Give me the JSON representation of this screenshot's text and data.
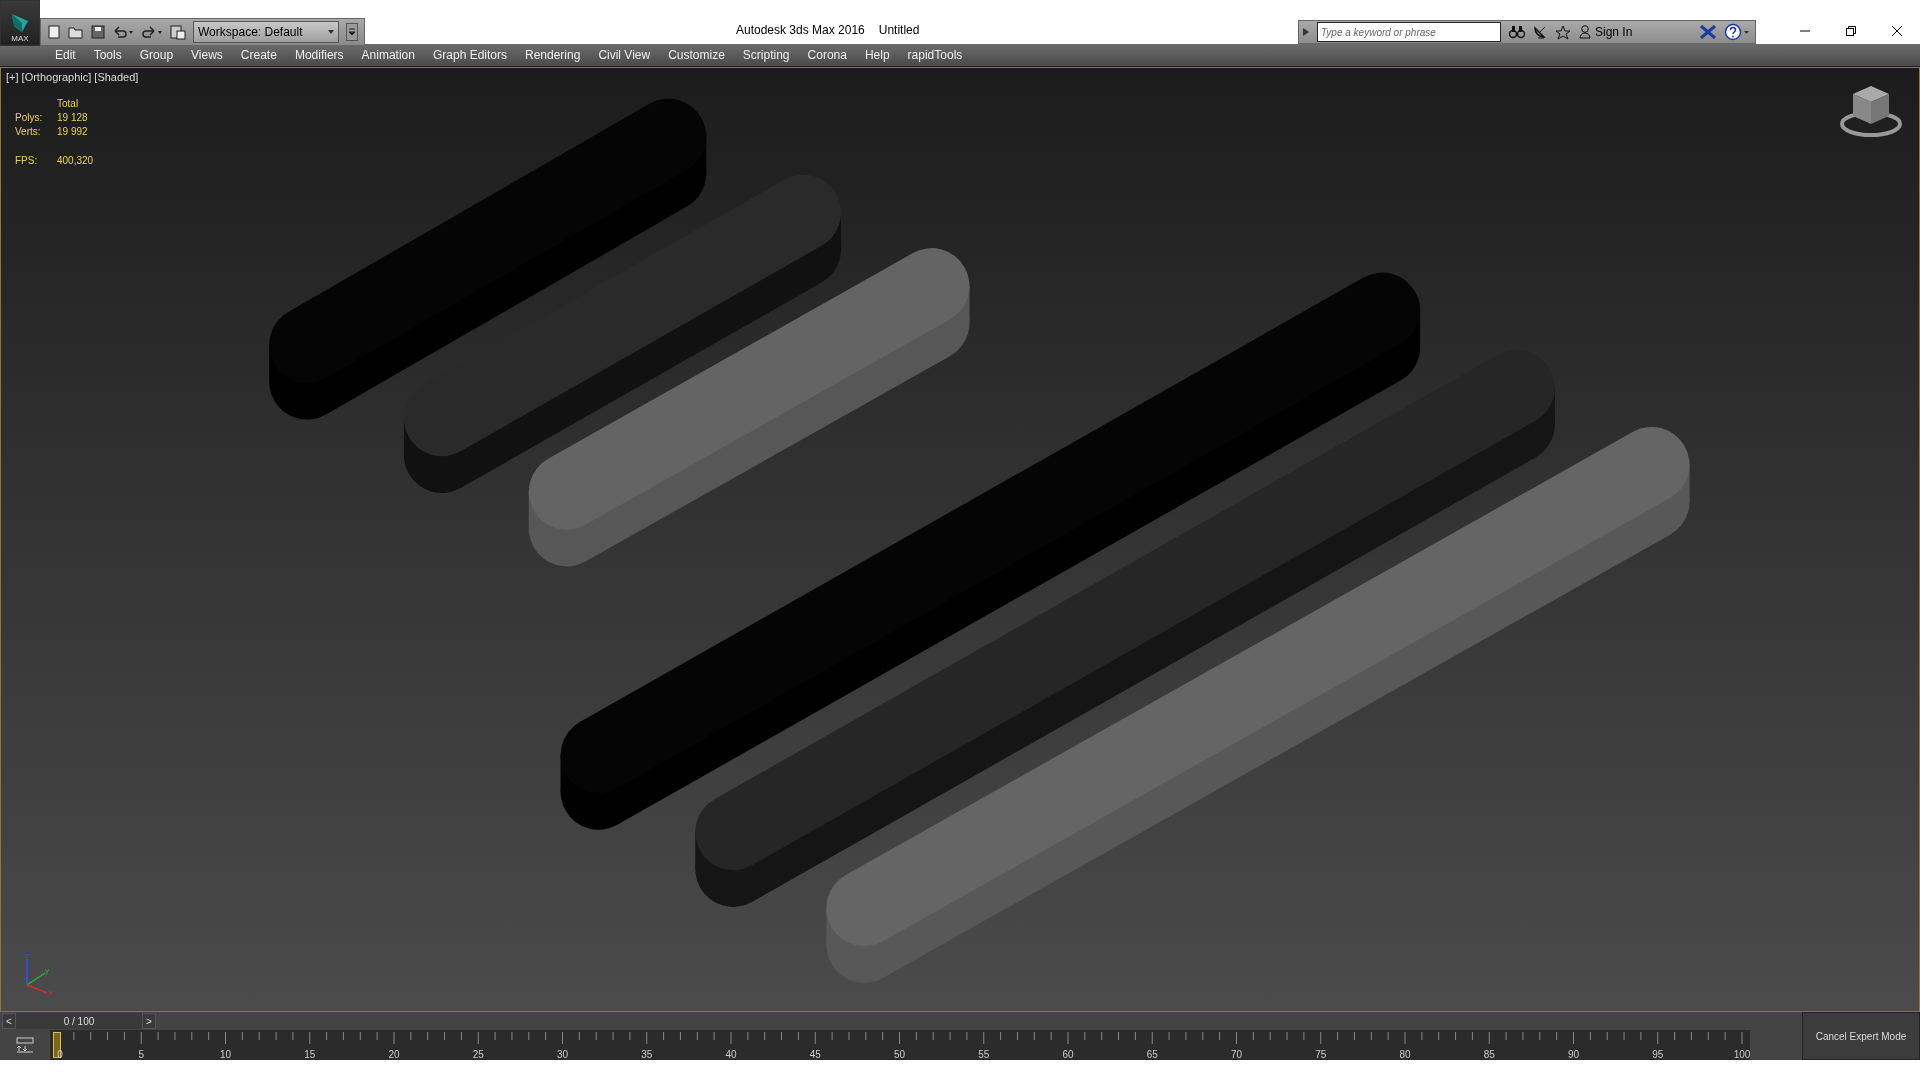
{
  "app_button": {
    "label": "MAX"
  },
  "workspace": {
    "value": "Workspace: Default"
  },
  "window": {
    "title": "Autodesk 3ds Max 2016",
    "document": "Untitled"
  },
  "search": {
    "placeholder": "Type a keyword or phrase"
  },
  "account": {
    "label": "Sign In"
  },
  "menu": [
    "Edit",
    "Tools",
    "Group",
    "Views",
    "Create",
    "Modifiers",
    "Animation",
    "Graph Editors",
    "Rendering",
    "Civil View",
    "Customize",
    "Scripting",
    "Corona",
    "Help",
    "rapidTools"
  ],
  "viewport": {
    "label": "[+] [Orthographic] [Shaded]",
    "stats": {
      "heading": "Total",
      "rows": [
        {
          "label": "Polys:",
          "value": "19 128"
        },
        {
          "label": "Verts:",
          "value": "19 992"
        }
      ],
      "fps": {
        "label": "FPS:",
        "value": "400,320"
      }
    },
    "axes": [
      "z",
      "y",
      "x"
    ]
  },
  "timeline": {
    "prev": "<",
    "next": ">",
    "frame": "0 / 100",
    "level": 0,
    "ticks": [
      "0",
      "5",
      "10",
      "15",
      "20",
      "25",
      "30",
      "35",
      "40",
      "45",
      "50",
      "55",
      "60",
      "65",
      "70",
      "75",
      "80",
      "85",
      "90",
      "95",
      "100"
    ]
  },
  "expert_button": {
    "label": "Cancel Expert Mode"
  }
}
